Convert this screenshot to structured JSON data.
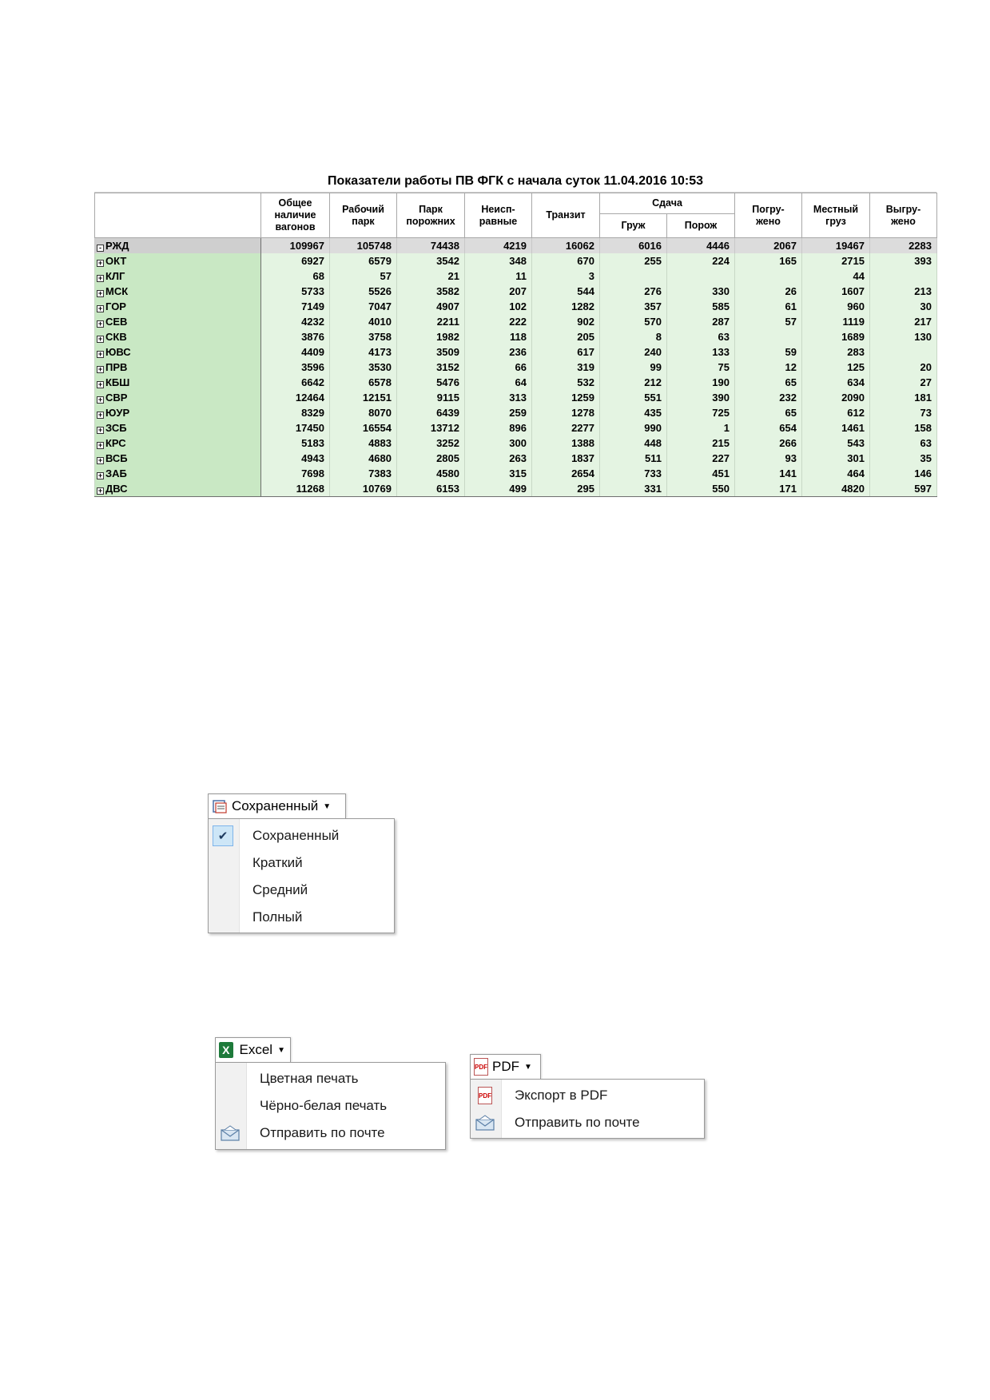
{
  "report": {
    "title": "Показатели работы ПВ ФГК с начала суток 11.04.2016 10:53",
    "headers": {
      "total_wagons": [
        "Общее",
        "наличие",
        "вагонов"
      ],
      "working_park": [
        "Рабочий",
        "парк"
      ],
      "empty_park": [
        "Парк",
        "порожних"
      ],
      "defective": [
        "Неисп-",
        "равные"
      ],
      "transit": "Транзит",
      "handover": "Сдача",
      "handover_loaded": "Груж",
      "handover_empty": "Порож",
      "loaded": [
        "Погру-",
        "жено"
      ],
      "local_cargo": [
        "Местный",
        "груз"
      ],
      "unloaded": [
        "Выгру-",
        "жено"
      ]
    },
    "rows": [
      {
        "name": "РЖД",
        "sign": "-",
        "cells": [
          "109967",
          "105748",
          "74438",
          "4219",
          "16062",
          "6016",
          "4446",
          "2067",
          "19467",
          "2283"
        ]
      },
      {
        "name": "ОКТ",
        "sign": "+",
        "cells": [
          "6927",
          "6579",
          "3542",
          "348",
          "670",
          "255",
          "224",
          "165",
          "2715",
          "393"
        ]
      },
      {
        "name": "КЛГ",
        "sign": "+",
        "cells": [
          "68",
          "57",
          "21",
          "11",
          "3",
          "",
          "",
          "",
          "44",
          ""
        ]
      },
      {
        "name": "МСК",
        "sign": "+",
        "cells": [
          "5733",
          "5526",
          "3582",
          "207",
          "544",
          "276",
          "330",
          "26",
          "1607",
          "213"
        ]
      },
      {
        "name": "ГОР",
        "sign": "+",
        "cells": [
          "7149",
          "7047",
          "4907",
          "102",
          "1282",
          "357",
          "585",
          "61",
          "960",
          "30"
        ]
      },
      {
        "name": "СЕВ",
        "sign": "+",
        "cells": [
          "4232",
          "4010",
          "2211",
          "222",
          "902",
          "570",
          "287",
          "57",
          "1119",
          "217"
        ]
      },
      {
        "name": "СКВ",
        "sign": "+",
        "cells": [
          "3876",
          "3758",
          "1982",
          "118",
          "205",
          "8",
          "63",
          "",
          "1689",
          "130"
        ]
      },
      {
        "name": "ЮВС",
        "sign": "+",
        "cells": [
          "4409",
          "4173",
          "3509",
          "236",
          "617",
          "240",
          "133",
          "59",
          "283",
          ""
        ]
      },
      {
        "name": "ПРВ",
        "sign": "+",
        "cells": [
          "3596",
          "3530",
          "3152",
          "66",
          "319",
          "99",
          "75",
          "12",
          "125",
          "20"
        ]
      },
      {
        "name": "КБШ",
        "sign": "+",
        "cells": [
          "6642",
          "6578",
          "5476",
          "64",
          "532",
          "212",
          "190",
          "65",
          "634",
          "27"
        ]
      },
      {
        "name": "СВР",
        "sign": "+",
        "cells": [
          "12464",
          "12151",
          "9115",
          "313",
          "1259",
          "551",
          "390",
          "232",
          "2090",
          "181"
        ]
      },
      {
        "name": "ЮУР",
        "sign": "+",
        "cells": [
          "8329",
          "8070",
          "6439",
          "259",
          "1278",
          "435",
          "725",
          "65",
          "612",
          "73"
        ]
      },
      {
        "name": "ЗСБ",
        "sign": "+",
        "cells": [
          "17450",
          "16554",
          "13712",
          "896",
          "2277",
          "990",
          "1",
          "654",
          "1461",
          "158"
        ]
      },
      {
        "name": "КРС",
        "sign": "+",
        "cells": [
          "5183",
          "4883",
          "3252",
          "300",
          "1388",
          "448",
          "215",
          "266",
          "543",
          "63"
        ]
      },
      {
        "name": "ВСБ",
        "sign": "+",
        "cells": [
          "4943",
          "4680",
          "2805",
          "263",
          "1837",
          "511",
          "227",
          "93",
          "301",
          "35"
        ]
      },
      {
        "name": "ЗАБ",
        "sign": "+",
        "cells": [
          "7698",
          "7383",
          "4580",
          "315",
          "2654",
          "733",
          "451",
          "141",
          "464",
          "146"
        ]
      },
      {
        "name": "ДВС",
        "sign": "+",
        "cells": [
          "11268",
          "10769",
          "6153",
          "499",
          "295",
          "331",
          "550",
          "171",
          "4820",
          "597"
        ]
      }
    ]
  },
  "view_menu": {
    "button_label": "Сохраненный",
    "button_icon": "saved-view-icon",
    "items": [
      {
        "label": "Сохраненный",
        "checked": true
      },
      {
        "label": "Краткий",
        "checked": false
      },
      {
        "label": "Средний",
        "checked": false
      },
      {
        "label": "Полный",
        "checked": false
      }
    ]
  },
  "excel_menu": {
    "button_label": "Excel",
    "button_icon": "excel-icon",
    "items": [
      {
        "label": "Цветная печать",
        "icon": ""
      },
      {
        "label": "Чёрно-белая печать",
        "icon": ""
      },
      {
        "label": "Отправить по почте",
        "icon": "mail-icon"
      }
    ]
  },
  "pdf_menu": {
    "button_label": "PDF",
    "button_icon": "pdf-icon",
    "items": [
      {
        "label": "Экспорт в PDF",
        "icon": "pdf-icon"
      },
      {
        "label": "Отправить по почте",
        "icon": "mail-icon"
      }
    ]
  },
  "colors": {
    "row_bg": "#e4f4e2",
    "rowname_bg": "#c9e8c4",
    "total_bg": "#dcdcdc",
    "check_bg": "#cde6f7"
  }
}
